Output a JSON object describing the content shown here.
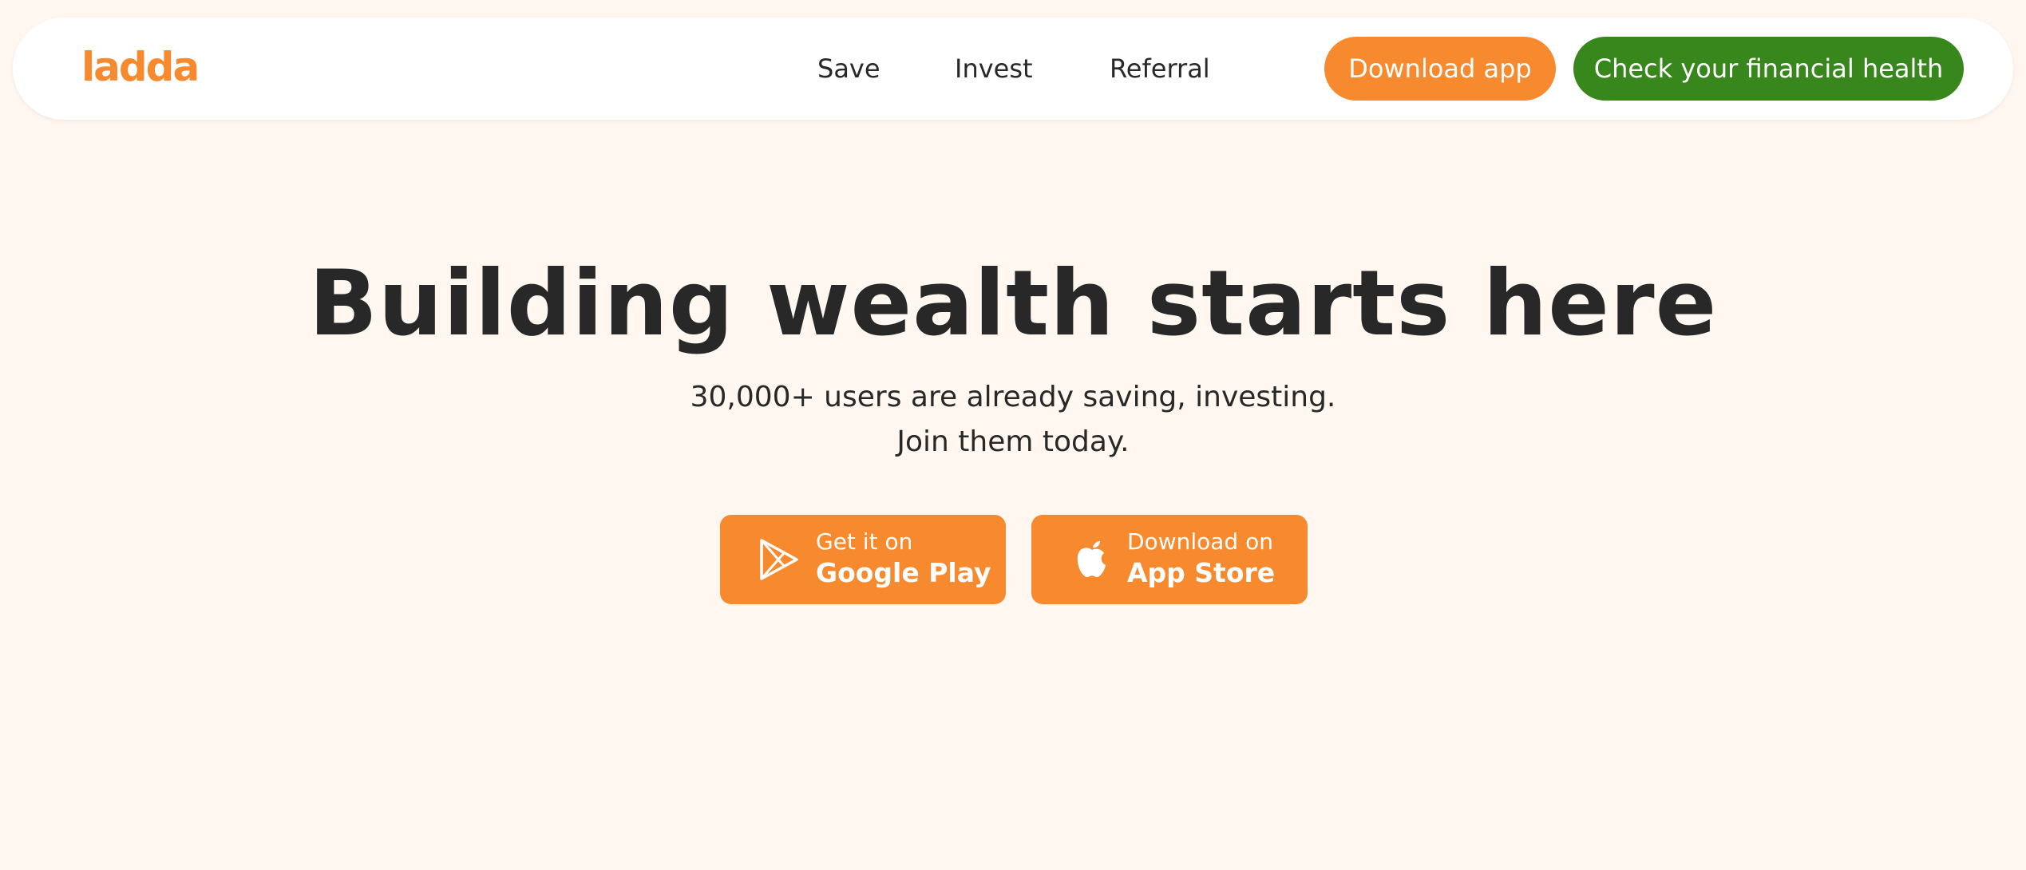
{
  "colors": {
    "page_background": "#FFF7F0",
    "navbar_background": "#FFFFFF",
    "brand_orange": "#F78A2F",
    "health_green": "#37871C",
    "text_dark": "#282828",
    "text_on_button": "#FFFFFF"
  },
  "header": {
    "logo_text": "ladda",
    "nav": {
      "save": "Save",
      "invest": "Invest",
      "referral": "Referral"
    },
    "download_app_label": "Download app",
    "financial_health_label": "Check your financial health"
  },
  "hero": {
    "title": "Building wealth starts here",
    "subtitle_line1": "30,000+ users are already saving, investing.",
    "subtitle_line2": "Join them today."
  },
  "stores": {
    "google": {
      "icon": "google-play-icon",
      "small_text": "Get it on",
      "big_text": "Google Play"
    },
    "apple": {
      "icon": "apple-icon",
      "small_text": "Download on",
      "big_text": "App Store"
    }
  }
}
